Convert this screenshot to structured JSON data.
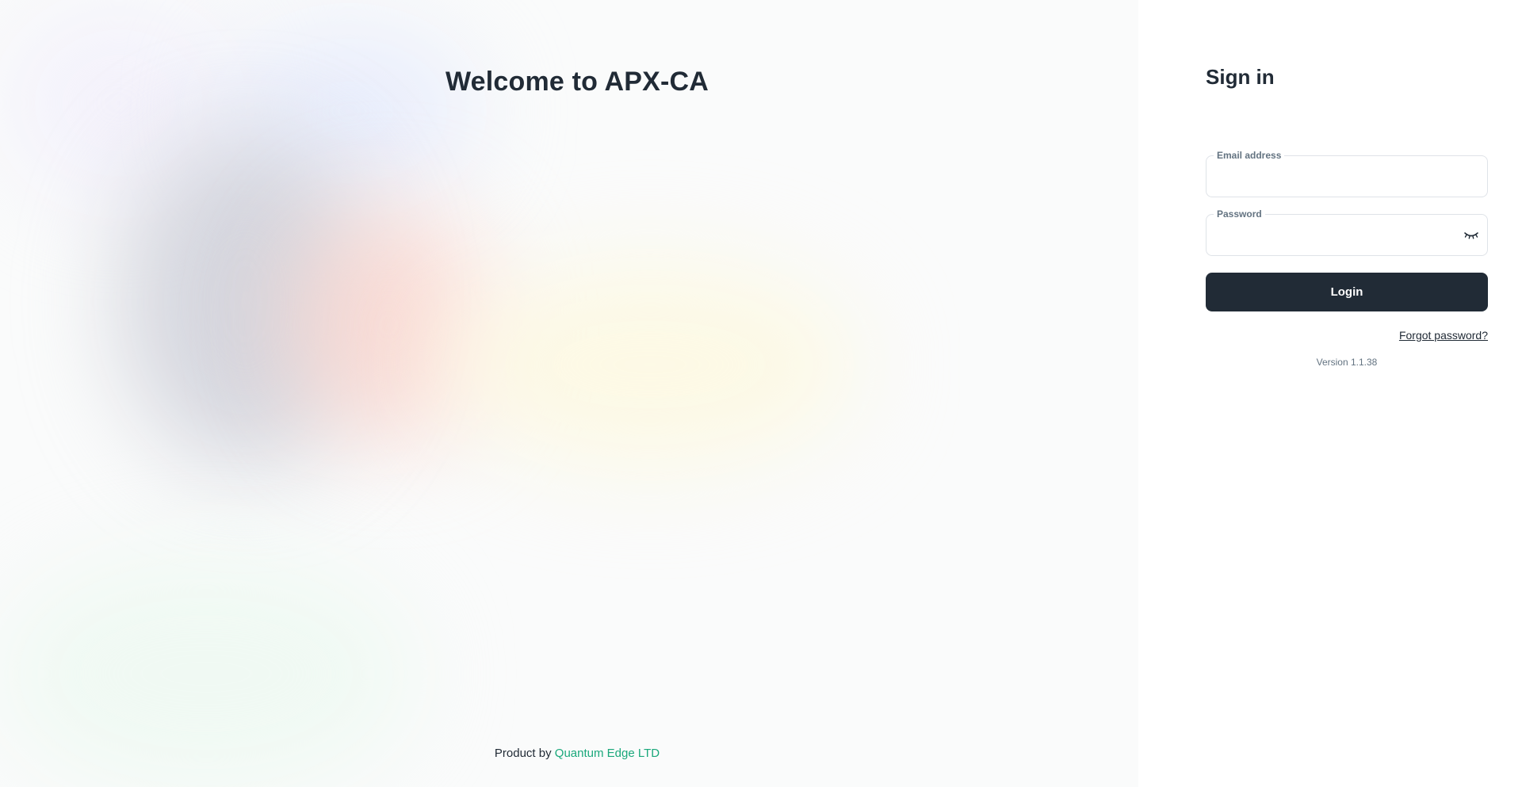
{
  "hero": {
    "title": "Welcome to APX-CA",
    "footer_prefix": "Product by",
    "footer_company": "Quantum Edge LTD"
  },
  "signin": {
    "title": "Sign in",
    "email_label": "Email address",
    "email_value": "",
    "password_label": "Password",
    "password_value": "",
    "password_toggle_icon": "eye-closed-icon",
    "login_label": "Login",
    "forgot_label": "Forgot password?",
    "version": "Version 1.1.38"
  },
  "colors": {
    "primary_dark": "#212b36",
    "link_green": "#1aa87b",
    "muted_text": "#637381",
    "border": "#dfe3e8"
  }
}
